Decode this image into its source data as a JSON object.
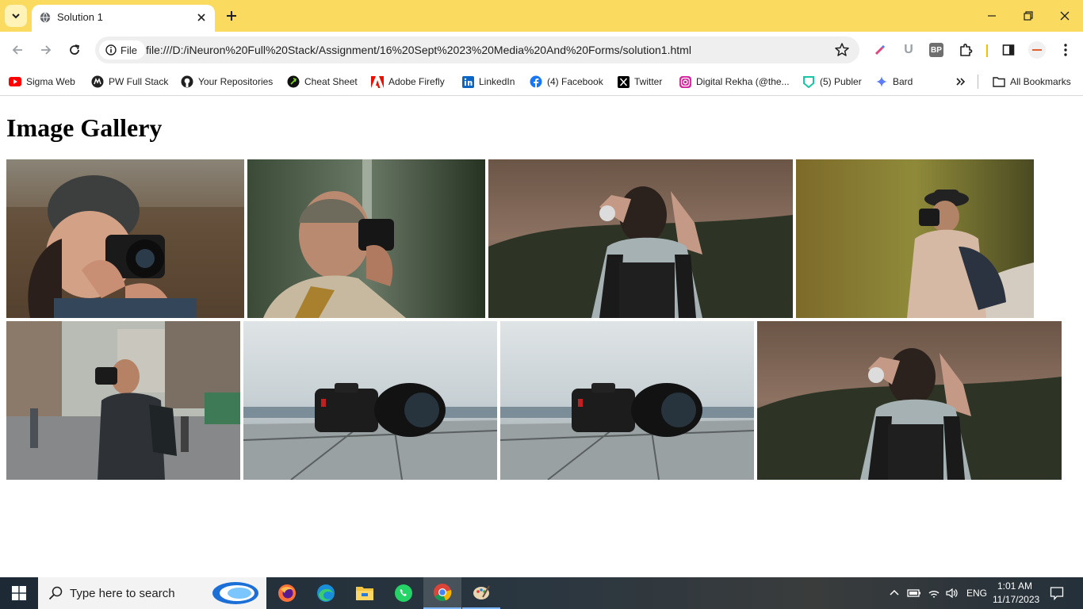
{
  "browser": {
    "tab": {
      "title": "Solution 1"
    },
    "omnibox": {
      "scheme_chip": "File",
      "url": "file:///D:/iNeuron%20Full%20Stack/Assignment/16%20Sept%2023%20Media%20And%20Forms/solution1.html"
    },
    "bookmarks": [
      {
        "label": "Sigma Web",
        "icon": "youtube-icon"
      },
      {
        "label": "PW Full Stack",
        "icon": "pw-icon"
      },
      {
        "label": "Your Repositories",
        "icon": "github-icon"
      },
      {
        "label": "Cheat Sheet",
        "icon": "cheatsheet-icon"
      },
      {
        "label": "Adobe Firefly",
        "icon": "adobe-icon"
      },
      {
        "label": "LinkedIn",
        "icon": "linkedin-icon"
      },
      {
        "label": "(4) Facebook",
        "icon": "facebook-icon"
      },
      {
        "label": "Twitter",
        "icon": "x-icon"
      },
      {
        "label": "Digital Rekha (@the...",
        "icon": "instagram-icon"
      },
      {
        "label": "(5) Publer",
        "icon": "publer-icon"
      },
      {
        "label": "Bard",
        "icon": "bard-icon"
      }
    ],
    "all_bookmarks": "All Bookmarks",
    "extensions": {
      "u": "U",
      "bp": "BP"
    },
    "colors": {
      "tabstrip": "#fadb5f",
      "omnibox": "#efefef"
    }
  },
  "page": {
    "heading": "Image Gallery",
    "images": [
      {
        "subject": "woman-in-beanie-with-camera"
      },
      {
        "subject": "man-in-cap-with-camera-in-forest"
      },
      {
        "subject": "man-in-plaid-shirt-from-behind"
      },
      {
        "subject": "man-in-hat-with-camera-on-path"
      },
      {
        "subject": "bearded-man-photographing-on-street"
      },
      {
        "subject": "dslr-camera-on-wooden-deck"
      },
      {
        "subject": "dslr-camera-on-wooden-deck"
      },
      {
        "subject": "man-in-plaid-shirt-from-behind"
      }
    ]
  },
  "taskbar": {
    "search_placeholder": "Type here to search",
    "language": "ENG",
    "time": "1:01 AM",
    "date": "11/17/2023"
  }
}
